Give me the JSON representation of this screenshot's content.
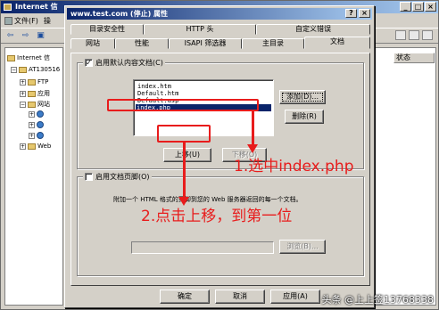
{
  "bg": {
    "title": "Internet 信",
    "menu": [
      "文件(F)",
      "操"
    ],
    "tree": [
      "Internet 信",
      "AT130516",
      "FTP",
      "应用",
      "网站",
      "Web"
    ],
    "list_header": "状态"
  },
  "dialog": {
    "title": "www.test.com (停止) 属性",
    "help_btn": "?",
    "close_btn": "×",
    "tabs_row1": [
      "目录安全性",
      "HTTP 头",
      "自定义错误"
    ],
    "tabs_row2": [
      "网站",
      "性能",
      "ISAPI 筛选器",
      "主目录",
      "文档"
    ],
    "group1": {
      "label": "启用默认内容文档(C)",
      "checked": "✓",
      "items": [
        "index.htm",
        "Default.htm",
        "Default.asp",
        "index.php"
      ],
      "selected": "index.php",
      "add_btn": "添加(D)...",
      "remove_btn": "删除(R)",
      "up_btn": "上移(U)",
      "down_btn": "下移(O)"
    },
    "group2": {
      "label": "启用文档页脚(O)",
      "desc": "附加一个 HTML 格式的页脚到您的 Web 服务器返回的每一个文档。",
      "browse_btn": "浏览(B)..."
    },
    "footer": {
      "ok": "确定",
      "cancel": "取消",
      "apply": "应用(A)"
    }
  },
  "annotations": {
    "step1": "1.选中index.php",
    "step2": "2.点击上移，到第一位",
    "color": "#e81c1c"
  },
  "watermark": "头条 @上上签13768338"
}
